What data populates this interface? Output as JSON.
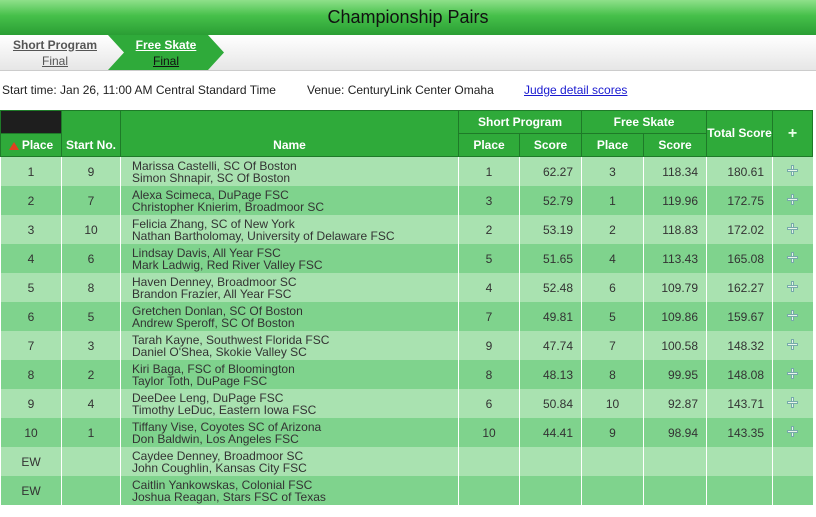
{
  "header": {
    "title": "Championship Pairs"
  },
  "segments": [
    {
      "label": "Short Program",
      "status": "Final"
    },
    {
      "label": "Free Skate",
      "status": "Final"
    }
  ],
  "info": {
    "start_time": "Start time: Jan 26, 11:00 AM Central Standard Time",
    "venue": "Venue: CenturyLink Center Omaha",
    "judge_link": "Judge detail scores"
  },
  "table": {
    "headers": {
      "place": "Place",
      "start_no": "Start No.",
      "name": "Name",
      "short_program": "Short Program",
      "free_skate": "Free Skate",
      "total_score": "Total Score",
      "sub_place": "Place",
      "sub_score": "Score",
      "expand": "+"
    },
    "rows": [
      {
        "place": "1",
        "start": "9",
        "name1": "Marissa Castelli, SC Of Boston",
        "name2": "Simon Shnapir, SC Of Boston",
        "sp_place": "1",
        "sp_score": "62.27",
        "fs_place": "3",
        "fs_score": "118.34",
        "total": "180.61"
      },
      {
        "place": "2",
        "start": "7",
        "name1": "Alexa Scimeca, DuPage FSC",
        "name2": "Christopher Knierim, Broadmoor SC",
        "sp_place": "3",
        "sp_score": "52.79",
        "fs_place": "1",
        "fs_score": "119.96",
        "total": "172.75"
      },
      {
        "place": "3",
        "start": "10",
        "name1": "Felicia Zhang, SC of New York",
        "name2": "Nathan Bartholomay, University of Delaware FSC",
        "sp_place": "2",
        "sp_score": "53.19",
        "fs_place": "2",
        "fs_score": "118.83",
        "total": "172.02"
      },
      {
        "place": "4",
        "start": "6",
        "name1": "Lindsay Davis, All Year FSC",
        "name2": "Mark Ladwig, Red River Valley FSC",
        "sp_place": "5",
        "sp_score": "51.65",
        "fs_place": "4",
        "fs_score": "113.43",
        "total": "165.08"
      },
      {
        "place": "5",
        "start": "8",
        "name1": "Haven Denney, Broadmoor SC",
        "name2": "Brandon Frazier, All Year FSC",
        "sp_place": "4",
        "sp_score": "52.48",
        "fs_place": "6",
        "fs_score": "109.79",
        "total": "162.27"
      },
      {
        "place": "6",
        "start": "5",
        "name1": "Gretchen Donlan, SC Of Boston",
        "name2": "Andrew Speroff, SC Of Boston",
        "sp_place": "7",
        "sp_score": "49.81",
        "fs_place": "5",
        "fs_score": "109.86",
        "total": "159.67"
      },
      {
        "place": "7",
        "start": "3",
        "name1": "Tarah Kayne, Southwest Florida FSC",
        "name2": "Daniel O'Shea, Skokie Valley SC",
        "sp_place": "9",
        "sp_score": "47.74",
        "fs_place": "7",
        "fs_score": "100.58",
        "total": "148.32"
      },
      {
        "place": "8",
        "start": "2",
        "name1": "Kiri Baga, FSC of Bloomington",
        "name2": "Taylor Toth, DuPage FSC",
        "sp_place": "8",
        "sp_score": "48.13",
        "fs_place": "8",
        "fs_score": "99.95",
        "total": "148.08"
      },
      {
        "place": "9",
        "start": "4",
        "name1": "DeeDee Leng, DuPage FSC",
        "name2": "Timothy LeDuc, Eastern Iowa FSC",
        "sp_place": "6",
        "sp_score": "50.84",
        "fs_place": "10",
        "fs_score": "92.87",
        "total": "143.71"
      },
      {
        "place": "10",
        "start": "1",
        "name1": "Tiffany Vise, Coyotes SC of Arizona",
        "name2": "Don Baldwin, Los Angeles FSC",
        "sp_place": "10",
        "sp_score": "44.41",
        "fs_place": "9",
        "fs_score": "98.94",
        "total": "143.35"
      },
      {
        "place": "EW",
        "start": "",
        "name1": "Caydee Denney, Broadmoor SC",
        "name2": "John Coughlin, Kansas City FSC",
        "sp_place": "",
        "sp_score": "",
        "fs_place": "",
        "fs_score": "",
        "total": ""
      },
      {
        "place": "EW",
        "start": "",
        "name1": "Caitlin Yankowskas, Colonial FSC",
        "name2": "Joshua Reagan, Stars FSC of Texas",
        "sp_place": "",
        "sp_score": "",
        "fs_place": "",
        "fs_score": "",
        "total": ""
      }
    ]
  },
  "colors": {
    "header_green": "#2faa3a",
    "row_light": "#a9e2b0",
    "row_dark": "#7fd38d",
    "sort_arrow": "#e04020"
  },
  "icons": {
    "expand": "plus-icon",
    "sort": "sort-up-arrow-icon"
  }
}
